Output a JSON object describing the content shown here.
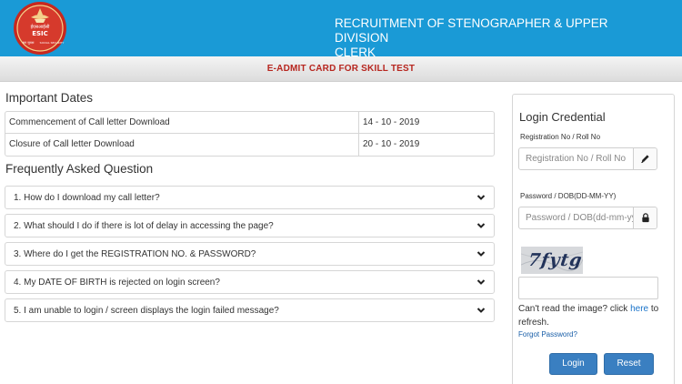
{
  "header": {
    "logo_text_top": "ईएसआईसी",
    "logo_text_center": "ESIC",
    "logo_text_bottom_left": "श्रम सुरक्षा",
    "logo_text_bottom_right": "SOCIAL SECURITY",
    "title_line1": "RECRUITMENT OF STENOGRAPHER & UPPER DIVISION",
    "title_line2": "CLERK",
    "bg_color": "#1a9ad6"
  },
  "subbar": {
    "title": "E-ADMIT CARD FOR SKILL TEST",
    "title_color": "#b7261f"
  },
  "important_dates": {
    "title": "Important Dates",
    "rows": [
      {
        "label": "Commencement of Call letter Download",
        "value": "14 - 10 - 2019"
      },
      {
        "label": "Closure of Call letter Download",
        "value": "20 - 10 - 2019"
      }
    ]
  },
  "faq": {
    "title": "Frequently Asked Question",
    "items": [
      {
        "question": "1. How do I download my call letter?",
        "icon": "chevron-down-icon"
      },
      {
        "question": "2. What should I do if there is lot of delay in accessing the page?",
        "icon": "chevron-down-icon"
      },
      {
        "question": "3. Where do I get the REGISTRATION NO. & PASSWORD?",
        "icon": "chevron-down-icon"
      },
      {
        "question": "4. My DATE OF BIRTH is rejected on login screen?",
        "icon": "chevron-down-icon"
      },
      {
        "question": "5. I am unable to login / screen displays the login failed message?",
        "icon": "chevron-down-icon"
      }
    ]
  },
  "login": {
    "title": "Login Credential",
    "registration": {
      "label": "Registration No / Roll No",
      "placeholder": "Registration No / Roll No",
      "value": "",
      "icon": "pencil-icon"
    },
    "password": {
      "label": "Password / DOB(DD-MM-YY)",
      "placeholder": "Password / DOB(dd-mm-yy)",
      "value": "",
      "icon": "lock-icon"
    },
    "captcha": {
      "text": "7fytg",
      "input_value": ""
    },
    "cant_read_prefix": "Can't read the image? click ",
    "cant_read_link": "here",
    "cant_read_suffix": " to refresh.",
    "forgot_password": "Forgot Password?",
    "login_button": "Login",
    "reset_button": "Reset",
    "button_color": "#3a7fc1"
  }
}
